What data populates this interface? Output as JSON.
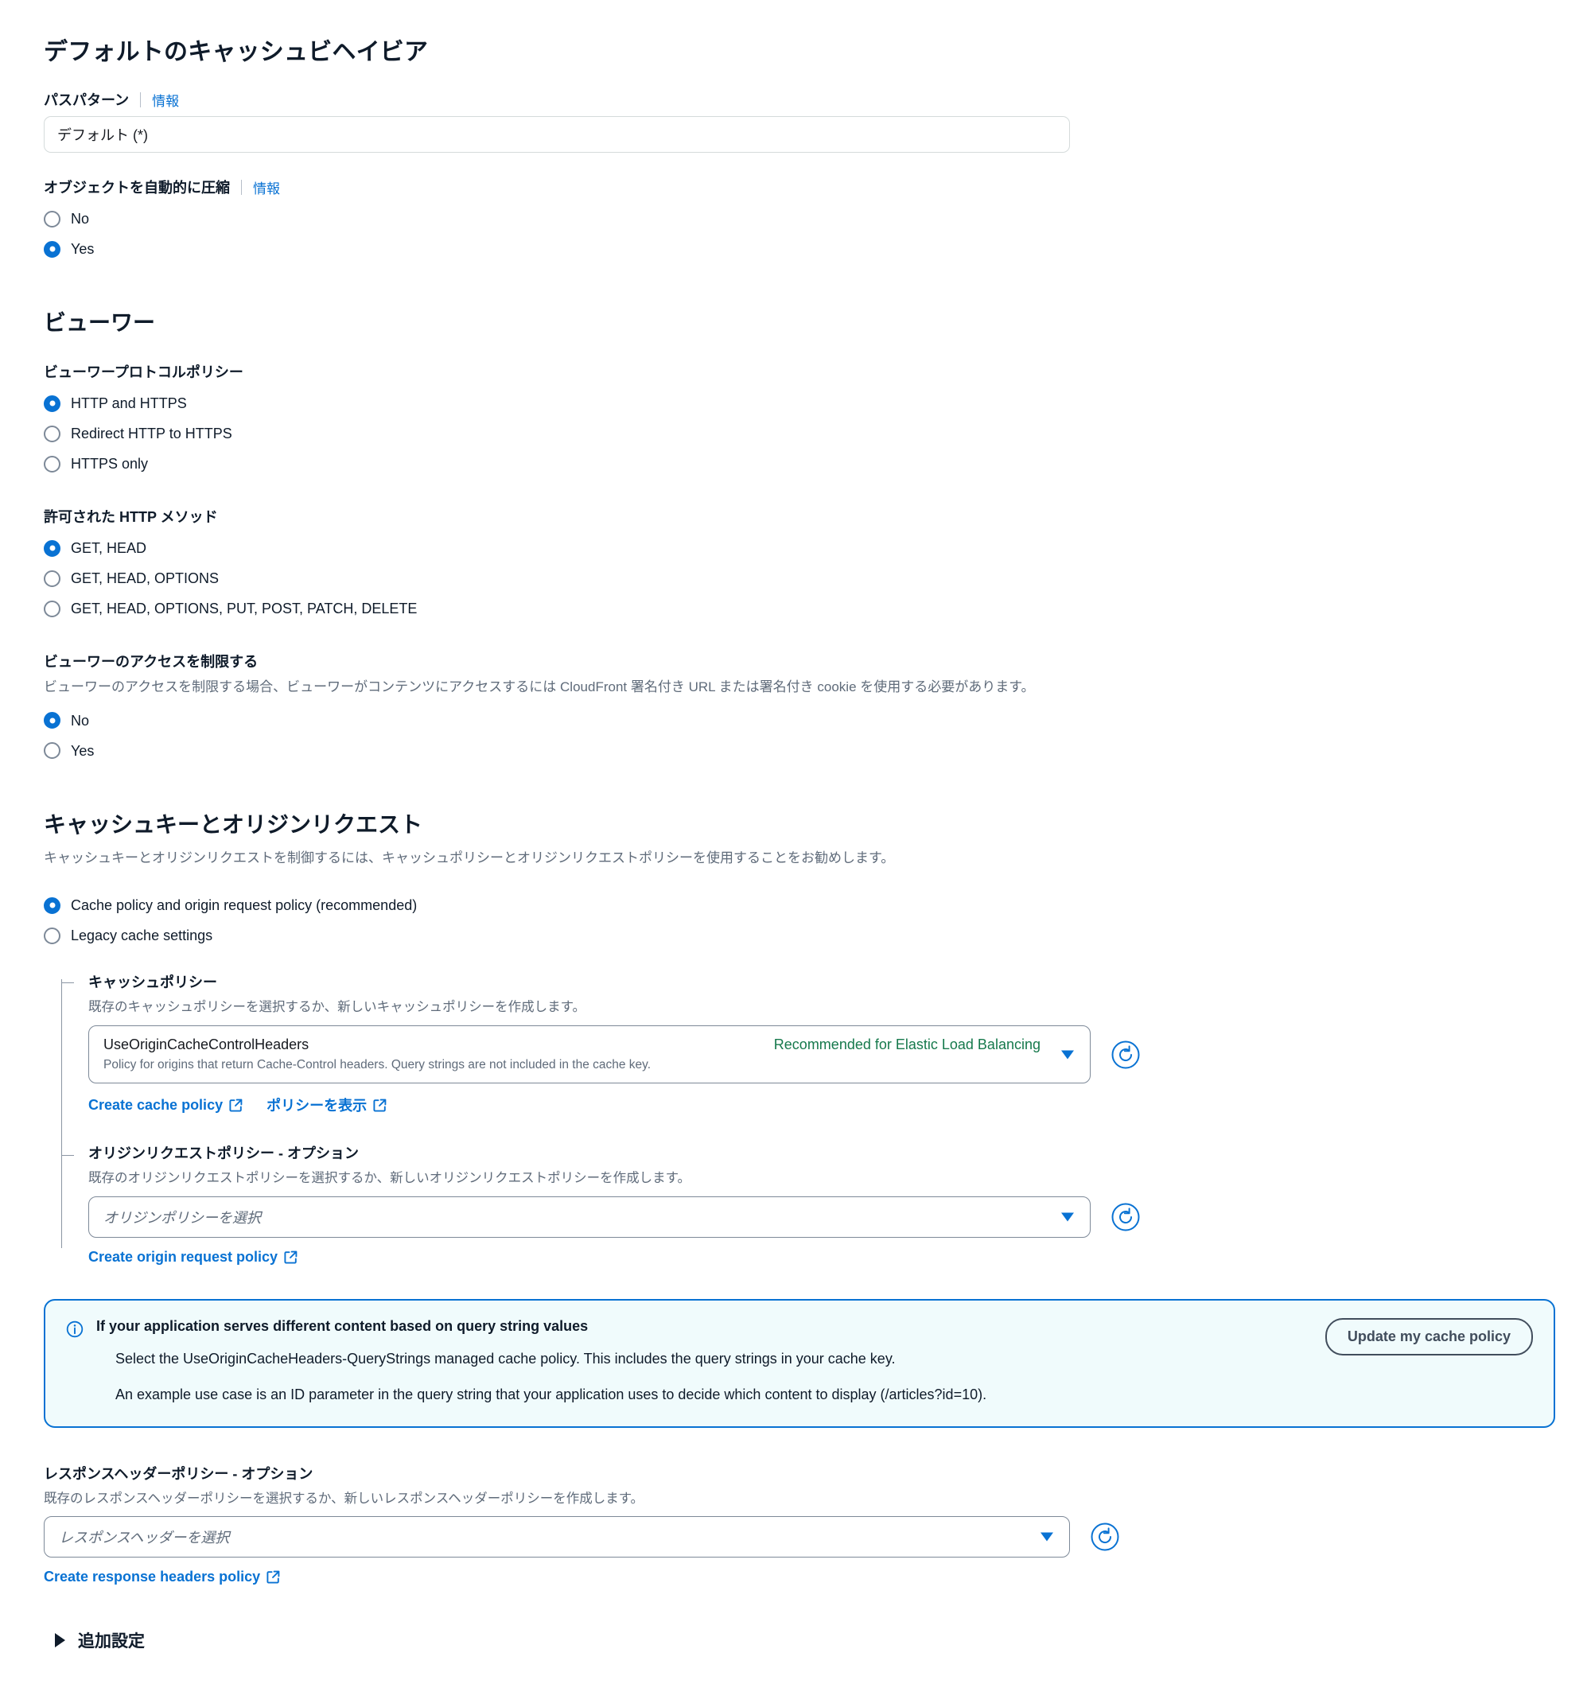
{
  "section_default_cache": {
    "title": "デフォルトのキャッシュビヘイビア",
    "path_pattern": {
      "label": "パスパターン",
      "info": "情報",
      "value": "デフォルト (*)"
    },
    "compress": {
      "label": "オブジェクトを自動的に圧縮",
      "info": "情報",
      "options": [
        "No",
        "Yes"
      ],
      "selected": "Yes"
    }
  },
  "section_viewer": {
    "title": "ビューワー",
    "protocol_policy": {
      "label": "ビューワープロトコルポリシー",
      "options": [
        "HTTP and HTTPS",
        "Redirect HTTP to HTTPS",
        "HTTPS only"
      ],
      "selected": "HTTP and HTTPS"
    },
    "http_methods": {
      "label": "許可された HTTP メソッド",
      "options": [
        "GET, HEAD",
        "GET, HEAD, OPTIONS",
        "GET, HEAD, OPTIONS, PUT, POST, PATCH, DELETE"
      ],
      "selected": "GET, HEAD"
    },
    "restrict_viewer_access": {
      "label": "ビューワーのアクセスを制限する",
      "description": "ビューワーのアクセスを制限する場合、ビューワーがコンテンツにアクセスするには CloudFront 署名付き URL または署名付き cookie を使用する必要があります。",
      "options": [
        "No",
        "Yes"
      ],
      "selected": "No"
    }
  },
  "section_cache_key": {
    "title": "キャッシュキーとオリジンリクエスト",
    "description": "キャッシュキーとオリジンリクエストを制御するには、キャッシュポリシーとオリジンリクエストポリシーを使用することをお勧めします。",
    "mode": {
      "options": [
        "Cache policy and origin request policy (recommended)",
        "Legacy cache settings"
      ],
      "selected": "Cache policy and origin request policy (recommended)"
    },
    "cache_policy": {
      "label": "キャッシュポリシー",
      "description": "既存のキャッシュポリシーを選択するか、新しいキャッシュポリシーを作成します。",
      "selected_value": "UseOriginCacheControlHeaders",
      "badge": "Recommended for Elastic Load Balancing",
      "selected_description": "Policy for origins that return Cache-Control headers. Query strings are not included in the cache key.",
      "links": [
        {
          "label": "Create cache policy",
          "icon": "external-link-icon"
        },
        {
          "label": "ポリシーを表示",
          "icon": "external-link-icon"
        }
      ],
      "refresh_icon": "refresh-icon"
    },
    "origin_request_policy": {
      "label": "オリジンリクエストポリシー - オプション",
      "description": "既存のオリジンリクエストポリシーを選択するか、新しいオリジンリクエストポリシーを作成します。",
      "placeholder": "オリジンポリシーを選択",
      "links": [
        {
          "label": "Create origin request policy",
          "icon": "external-link-icon"
        }
      ],
      "refresh_icon": "refresh-icon"
    },
    "alert": {
      "icon": "info-icon",
      "title": "If your application serves different content based on query string values",
      "line1": "Select the UseOriginCacheHeaders-QueryStrings managed cache policy. This includes the query strings in your cache key.",
      "line2": "An example use case is an ID parameter in the query string that your application uses to decide which content to display (/articles?id=10).",
      "button": "Update my cache policy",
      "accent_color": "#0972d3",
      "background_color": "#f0fbfc"
    }
  },
  "section_response_headers": {
    "label": "レスポンスヘッダーポリシー - オプション",
    "description": "既存のレスポンスヘッダーポリシーを選択するか、新しいレスポンスヘッダーポリシーを作成します。",
    "placeholder": "レスポンスヘッダーを選択",
    "links": [
      {
        "label": "Create response headers policy",
        "icon": "external-link-icon"
      }
    ],
    "refresh_icon": "refresh-icon"
  },
  "additional_settings": {
    "label": "追加設定",
    "expanded": false,
    "icon": "triangle-right-icon"
  },
  "colors": {
    "link_blue": "#0972d3",
    "badge_green": "#16794c",
    "text_primary": "#0f1b2a",
    "text_secondary": "#5f6b7a"
  }
}
